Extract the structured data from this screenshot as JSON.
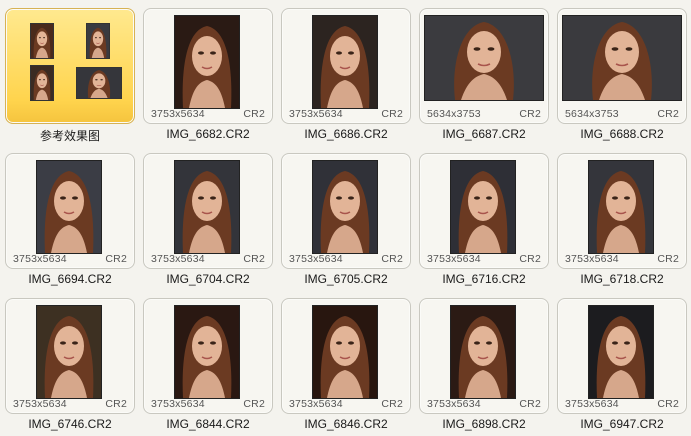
{
  "items": [
    {
      "name": "参考效果图",
      "selected": true
    },
    {
      "name": "IMG_6682.CR2",
      "dims": "3753x5634",
      "fmt": "CR2",
      "orient": "portrait",
      "bg": "#2a1a14"
    },
    {
      "name": "IMG_6686.CR2",
      "dims": "3753x5634",
      "fmt": "CR2",
      "orient": "portrait",
      "bg": "#2c2420"
    },
    {
      "name": "IMG_6687.CR2",
      "dims": "5634x3753",
      "fmt": "CR2",
      "orient": "landscape",
      "bg": "#3b3b3f"
    },
    {
      "name": "IMG_6688.CR2",
      "dims": "5634x3753",
      "fmt": "CR2",
      "orient": "landscape",
      "bg": "#3a3a3e"
    },
    {
      "name": "IMG_6694.CR2",
      "dims": "3753x5634",
      "fmt": "CR2",
      "orient": "portrait",
      "bg": "#3b3d45"
    },
    {
      "name": "IMG_6704.CR2",
      "dims": "3753x5634",
      "fmt": "CR2",
      "orient": "portrait",
      "bg": "#33343a"
    },
    {
      "name": "IMG_6705.CR2",
      "dims": "3753x5634",
      "fmt": "CR2",
      "orient": "portrait",
      "bg": "#303138"
    },
    {
      "name": "IMG_6716.CR2",
      "dims": "3753x5634",
      "fmt": "CR2",
      "orient": "portrait",
      "bg": "#2e2f36"
    },
    {
      "name": "IMG_6718.CR2",
      "dims": "3753x5634",
      "fmt": "CR2",
      "orient": "portrait",
      "bg": "#34353b"
    },
    {
      "name": "IMG_6746.CR2",
      "dims": "3753x5634",
      "fmt": "CR2",
      "orient": "portrait",
      "bg": "#3d3022"
    },
    {
      "name": "IMG_6844.CR2",
      "dims": "3753x5634",
      "fmt": "CR2",
      "orient": "portrait",
      "bg": "#2a1812"
    },
    {
      "name": "IMG_6846.CR2",
      "dims": "3753x5634",
      "fmt": "CR2",
      "orient": "portrait",
      "bg": "#28160f"
    },
    {
      "name": "IMG_6898.CR2",
      "dims": "3753x5634",
      "fmt": "CR2",
      "orient": "portrait",
      "bg": "#2b1a14"
    },
    {
      "name": "IMG_6947.CR2",
      "dims": "3753x5634",
      "fmt": "CR2",
      "orient": "portrait",
      "bg": "#1c1c1f"
    }
  ],
  "colors": {
    "page_bg": "#f4f3ee",
    "selected_bg": "#ffd44d",
    "hair": "#6b3a22",
    "skin": "#e2b497"
  }
}
